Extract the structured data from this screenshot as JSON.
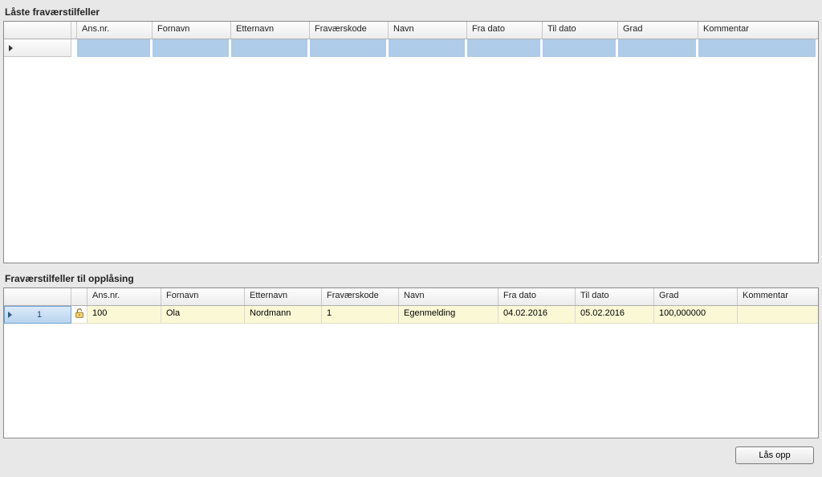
{
  "upper": {
    "title": "Låste fraværstilfeller",
    "columns": {
      "ansnr": "Ans.nr.",
      "fornavn": "Fornavn",
      "etternavn": "Etternavn",
      "fravaerskode": "Fraværskode",
      "navn": "Navn",
      "fradato": "Fra dato",
      "tildato": "Til dato",
      "grad": "Grad",
      "kommentar": "Kommentar"
    },
    "rows": [
      {
        "ansnr": "",
        "fornavn": "",
        "etternavn": "",
        "fravaerskode": "",
        "navn": "",
        "fradato": "",
        "tildato": "",
        "grad": "",
        "kommentar": ""
      }
    ]
  },
  "lower": {
    "title": "Fraværstilfeller til opplåsing",
    "columns": {
      "ansnr": "Ans.nr.",
      "fornavn": "Fornavn",
      "etternavn": "Etternavn",
      "fravaerskode": "Fraværskode",
      "navn": "Navn",
      "fradato": "Fra dato",
      "tildato": "Til dato",
      "grad": "Grad",
      "kommentar": "Kommentar"
    },
    "rows": [
      {
        "rownum": "1",
        "icon": "unlock-icon",
        "ansnr": "100",
        "fornavn": "Ola",
        "etternavn": "Nordmann",
        "fravaerskode": "1",
        "navn": "Egenmelding",
        "fradato": "04.02.2016",
        "tildato": "05.02.2016",
        "grad": "100,000000",
        "kommentar": ""
      }
    ]
  },
  "footer": {
    "unlock_button": "Lås opp"
  }
}
